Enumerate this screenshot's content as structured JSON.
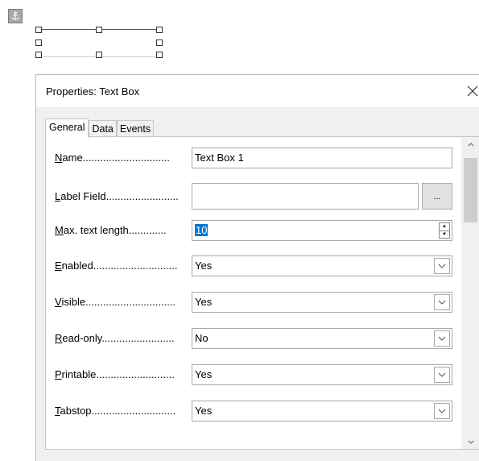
{
  "canvas": {
    "anchor_icon": "anchor-icon"
  },
  "dialog": {
    "title": "Properties: Text Box",
    "close_icon": "close-icon",
    "tabs": [
      {
        "label": "General",
        "active": true
      },
      {
        "label": "Data",
        "active": false
      },
      {
        "label": "Events",
        "active": false
      }
    ],
    "fields": [
      {
        "label": "Name",
        "underline": "N",
        "rest": "ame..............................",
        "value": "Text Box 1"
      },
      {
        "label": "Label Field",
        "underline": "L",
        "rest": "abel Field.........................",
        "value": "",
        "button": "..."
      },
      {
        "label": "Max. text length",
        "underline": "M",
        "rest": "ax. text length.............",
        "value": "10"
      },
      {
        "label": "Enabled",
        "underline": "E",
        "rest": "nabled.............................",
        "value": "Yes"
      },
      {
        "label": "Visible",
        "underline": "V",
        "rest": "isible...............................",
        "value": "Yes"
      },
      {
        "label": "Read-only",
        "underline": "R",
        "rest": "ead-only.........................",
        "value": "No"
      },
      {
        "label": "Printable",
        "underline": "P",
        "rest": "rintable...........................",
        "value": "Yes"
      },
      {
        "label": "Tabstop",
        "underline": "T",
        "rest": "abstop.............................",
        "value": "Yes"
      }
    ]
  }
}
